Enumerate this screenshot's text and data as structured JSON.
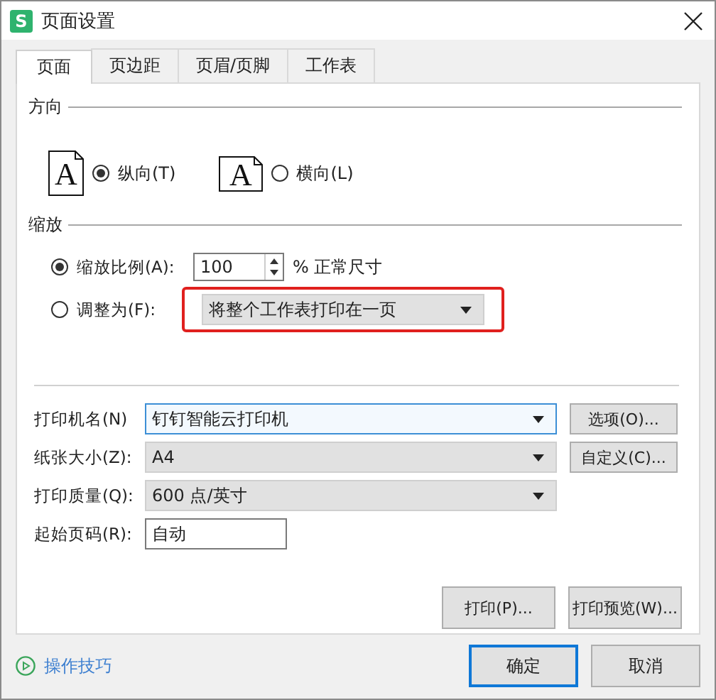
{
  "window": {
    "title": "页面设置",
    "icon_letter": "S"
  },
  "tabs": [
    {
      "label": "页面",
      "selected": true
    },
    {
      "label": "页边距",
      "selected": false
    },
    {
      "label": "页眉/页脚",
      "selected": false
    },
    {
      "label": "工作表",
      "selected": false
    }
  ],
  "orientation": {
    "title": "方向",
    "options": [
      {
        "label": "纵向(T)",
        "selected": true,
        "kind": "portrait",
        "icon_letter": "A"
      },
      {
        "label": "横向(L)",
        "selected": false,
        "kind": "landscape",
        "icon_letter": "A"
      }
    ]
  },
  "scaling": {
    "title": "缩放",
    "options": [
      {
        "label": "缩放比例(A):",
        "selected": true,
        "kind": "spinner",
        "value": "100",
        "suffix": "% 正常尺寸"
      },
      {
        "label": "调整为(F):",
        "selected": false,
        "kind": "dropdown",
        "value": "将整个工作表打印在一页",
        "highlighted": true
      }
    ]
  },
  "fields": [
    {
      "label": "打印机名(N)",
      "kind": "dropdown",
      "value": "钉钉智能云打印机",
      "focused": true,
      "button": "选项(O)..."
    },
    {
      "label": "纸张大小(Z):",
      "kind": "dropdown",
      "value": "A4",
      "focused": false,
      "button": "自定义(C)..."
    },
    {
      "label": "打印质量(Q):",
      "kind": "dropdown",
      "value": "600 点/英寸",
      "focused": false
    },
    {
      "label": "起始页码(R):",
      "kind": "text",
      "value": "自动"
    }
  ],
  "panel_buttons": [
    "打印(P)...",
    "打印预览(W)..."
  ],
  "footer": {
    "link": "操作技巧",
    "buttons": [
      {
        "label": "确定",
        "default": true
      },
      {
        "label": "取消",
        "default": false
      }
    ]
  }
}
